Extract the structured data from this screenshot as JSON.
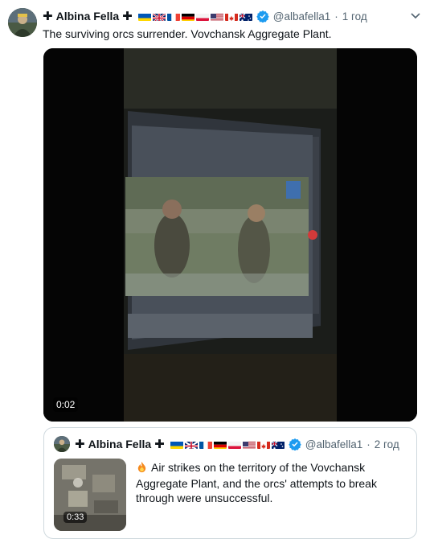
{
  "tweet": {
    "author_name": "Albina Fella",
    "cross_symbol": "✚",
    "handle": "@albafella1",
    "separator": "·",
    "time": "1 год",
    "text": "The surviving orcs surrender. Vovchansk Aggregate Plant.",
    "flags": [
      "ukraine-flag",
      "uk-flag",
      "france-flag",
      "germany-flag",
      "poland-flag",
      "usa-flag",
      "canada-flag",
      "australia-flag"
    ],
    "verified_color": "#1d9bf0",
    "video": {
      "duration": "0:02"
    }
  },
  "quote": {
    "author_name": "Albina Fella",
    "cross_symbol": "✚",
    "handle": "@albafella1",
    "separator": "·",
    "time": "2 год",
    "text": "Air strikes on the territory of the Vovchansk Aggregate Plant, and the orcs' attempts to break through were unsuccessful.",
    "thumb_duration": "0:33"
  },
  "colors": {
    "text": "#0f1419",
    "secondary": "#536471",
    "border": "#cfd9de",
    "accent": "#1d9bf0"
  }
}
